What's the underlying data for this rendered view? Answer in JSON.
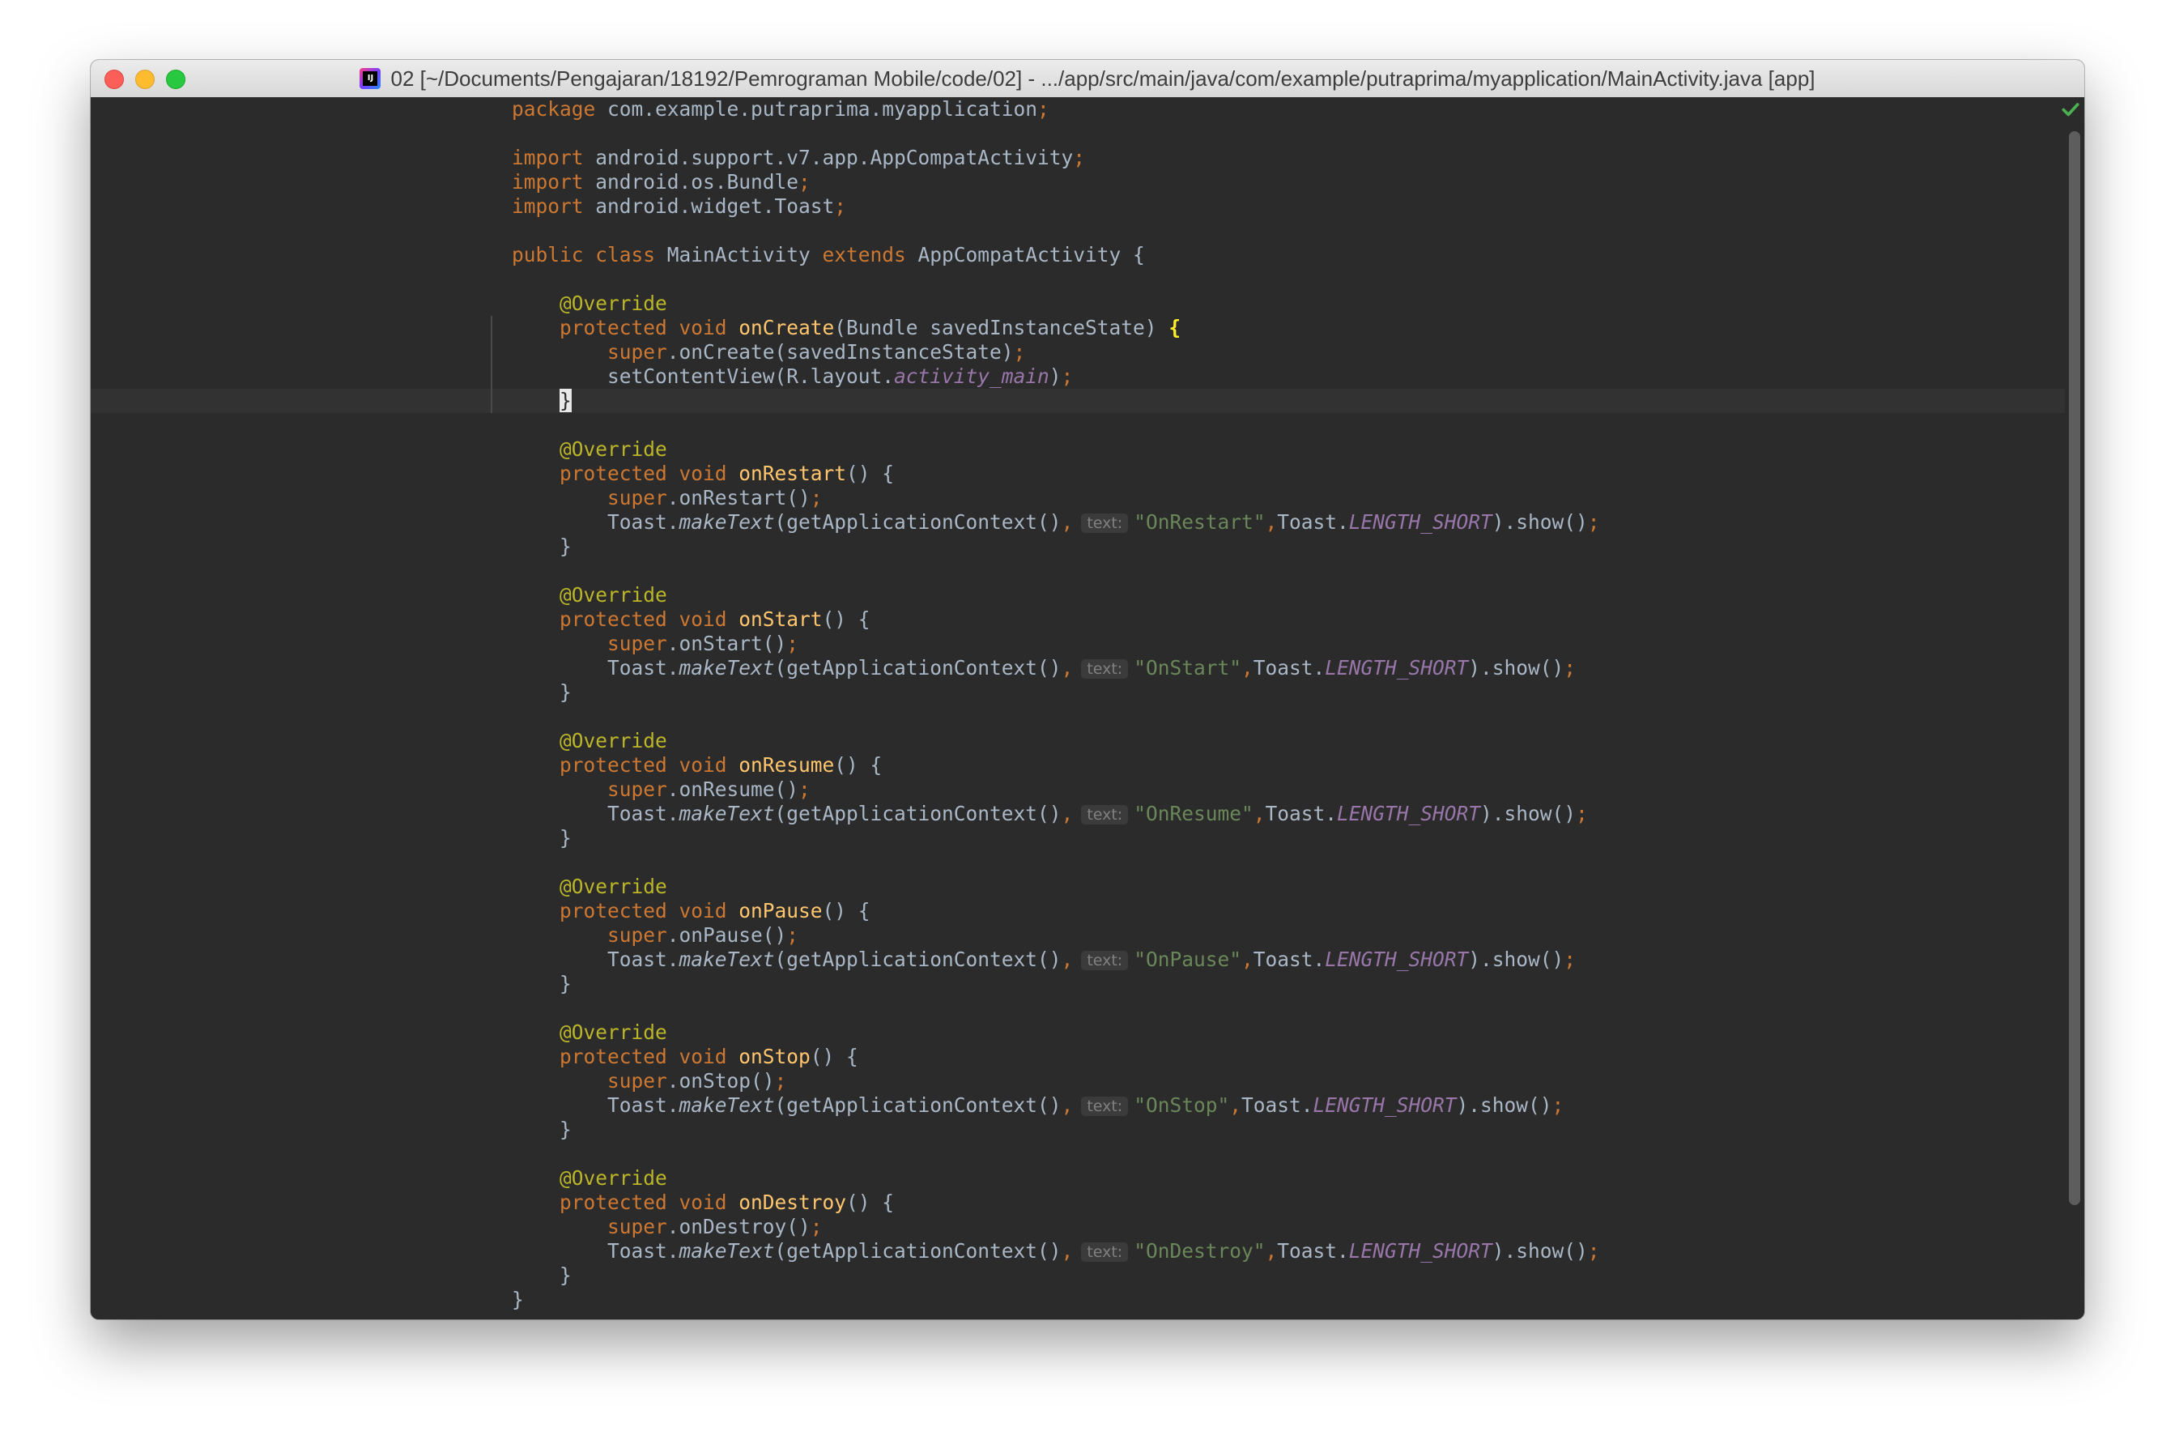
{
  "window": {
    "title": "02 [~/Documents/Pengajaran/18192/Pemrograman Mobile/code/02] - .../app/src/main/java/com/example/putraprima/myapplication/MainActivity.java [app]",
    "app_icon": "intellij-idea-icon",
    "status_icon": "check-icon"
  },
  "colors": {
    "keyword": "#cc7832",
    "method": "#ffc66d",
    "annotation": "#bbb529",
    "field": "#9876aa",
    "string": "#6a8759",
    "text": "#a9b7c6",
    "background": "#2b2b2b",
    "status_ok": "#4caf50"
  },
  "editor": {
    "cursor_line": 13,
    "lines": [
      [
        {
          "t": "package",
          "c": "keyword"
        },
        {
          "t": " com.example.putraprima.myapplication",
          "c": "plain"
        },
        {
          "t": ";",
          "c": "punct"
        }
      ],
      [],
      [
        {
          "t": "import",
          "c": "keyword"
        },
        {
          "t": " android.support.v7.app.AppCompatActivity",
          "c": "plain"
        },
        {
          "t": ";",
          "c": "punct"
        }
      ],
      [
        {
          "t": "import",
          "c": "keyword"
        },
        {
          "t": " android.os.Bundle",
          "c": "plain"
        },
        {
          "t": ";",
          "c": "punct"
        }
      ],
      [
        {
          "t": "import",
          "c": "keyword"
        },
        {
          "t": " android.widget.Toast",
          "c": "plain"
        },
        {
          "t": ";",
          "c": "punct"
        }
      ],
      [],
      [
        {
          "t": "public class ",
          "c": "keyword"
        },
        {
          "t": "MainActivity ",
          "c": "plain"
        },
        {
          "t": "extends ",
          "c": "keyword"
        },
        {
          "t": "AppCompatActivity {",
          "c": "plain"
        }
      ],
      [],
      [
        {
          "t": "    ",
          "c": "plain"
        },
        {
          "t": "@Override",
          "c": "annotation"
        }
      ],
      [
        {
          "t": "    ",
          "c": "plain"
        },
        {
          "t": "protected void ",
          "c": "keyword"
        },
        {
          "t": "onCreate",
          "c": "method"
        },
        {
          "t": "(Bundle savedInstanceState) ",
          "c": "plain"
        },
        {
          "t": "{",
          "c": "brace-hl"
        }
      ],
      [
        {
          "t": "        ",
          "c": "plain"
        },
        {
          "t": "super",
          "c": "keyword"
        },
        {
          "t": ".onCreate(savedInstanceState)",
          "c": "plain"
        },
        {
          "t": ";",
          "c": "punct"
        }
      ],
      [
        {
          "t": "        setContentView(R.layout.",
          "c": "plain"
        },
        {
          "t": "activity_main",
          "c": "field"
        },
        {
          "t": ")",
          "c": "plain"
        },
        {
          "t": ";",
          "c": "punct"
        }
      ],
      [
        {
          "t": "    ",
          "c": "plain"
        },
        {
          "t": "}",
          "c": "cursor"
        }
      ],
      [],
      [
        {
          "t": "    ",
          "c": "plain"
        },
        {
          "t": "@Override",
          "c": "annotation"
        }
      ],
      [
        {
          "t": "    ",
          "c": "plain"
        },
        {
          "t": "protected void ",
          "c": "keyword"
        },
        {
          "t": "onRestart",
          "c": "method"
        },
        {
          "t": "() {",
          "c": "plain"
        }
      ],
      [
        {
          "t": "        ",
          "c": "plain"
        },
        {
          "t": "super",
          "c": "keyword"
        },
        {
          "t": ".onRestart()",
          "c": "plain"
        },
        {
          "t": ";",
          "c": "punct"
        }
      ],
      [
        {
          "t": "        Toast.",
          "c": "plain"
        },
        {
          "t": "makeText",
          "c": "static"
        },
        {
          "t": "(getApplicationContext()",
          "c": "plain"
        },
        {
          "t": ",",
          "c": "punct"
        },
        {
          "t": "text:",
          "c": "hint"
        },
        {
          "t": "\"OnRestart\"",
          "c": "string"
        },
        {
          "t": ",",
          "c": "punct"
        },
        {
          "t": "Toast.",
          "c": "plain"
        },
        {
          "t": "LENGTH_SHORT",
          "c": "field"
        },
        {
          "t": ").show()",
          "c": "plain"
        },
        {
          "t": ";",
          "c": "punct"
        }
      ],
      [
        {
          "t": "    }",
          "c": "plain"
        }
      ],
      [],
      [
        {
          "t": "    ",
          "c": "plain"
        },
        {
          "t": "@Override",
          "c": "annotation"
        }
      ],
      [
        {
          "t": "    ",
          "c": "plain"
        },
        {
          "t": "protected void ",
          "c": "keyword"
        },
        {
          "t": "onStart",
          "c": "method"
        },
        {
          "t": "() {",
          "c": "plain"
        }
      ],
      [
        {
          "t": "        ",
          "c": "plain"
        },
        {
          "t": "super",
          "c": "keyword"
        },
        {
          "t": ".onStart()",
          "c": "plain"
        },
        {
          "t": ";",
          "c": "punct"
        }
      ],
      [
        {
          "t": "        Toast.",
          "c": "plain"
        },
        {
          "t": "makeText",
          "c": "static"
        },
        {
          "t": "(getApplicationContext()",
          "c": "plain"
        },
        {
          "t": ",",
          "c": "punct"
        },
        {
          "t": "text:",
          "c": "hint"
        },
        {
          "t": "\"OnStart\"",
          "c": "string"
        },
        {
          "t": ",",
          "c": "punct"
        },
        {
          "t": "Toast.",
          "c": "plain"
        },
        {
          "t": "LENGTH_SHORT",
          "c": "field"
        },
        {
          "t": ").show()",
          "c": "plain"
        },
        {
          "t": ";",
          "c": "punct"
        }
      ],
      [
        {
          "t": "    }",
          "c": "plain"
        }
      ],
      [],
      [
        {
          "t": "    ",
          "c": "plain"
        },
        {
          "t": "@Override",
          "c": "annotation"
        }
      ],
      [
        {
          "t": "    ",
          "c": "plain"
        },
        {
          "t": "protected void ",
          "c": "keyword"
        },
        {
          "t": "onResume",
          "c": "method"
        },
        {
          "t": "() {",
          "c": "plain"
        }
      ],
      [
        {
          "t": "        ",
          "c": "plain"
        },
        {
          "t": "super",
          "c": "keyword"
        },
        {
          "t": ".onResume()",
          "c": "plain"
        },
        {
          "t": ";",
          "c": "punct"
        }
      ],
      [
        {
          "t": "        Toast.",
          "c": "plain"
        },
        {
          "t": "makeText",
          "c": "static"
        },
        {
          "t": "(getApplicationContext()",
          "c": "plain"
        },
        {
          "t": ",",
          "c": "punct"
        },
        {
          "t": "text:",
          "c": "hint"
        },
        {
          "t": "\"OnResume\"",
          "c": "string"
        },
        {
          "t": ",",
          "c": "punct"
        },
        {
          "t": "Toast.",
          "c": "plain"
        },
        {
          "t": "LENGTH_SHORT",
          "c": "field"
        },
        {
          "t": ").show()",
          "c": "plain"
        },
        {
          "t": ";",
          "c": "punct"
        }
      ],
      [
        {
          "t": "    }",
          "c": "plain"
        }
      ],
      [],
      [
        {
          "t": "    ",
          "c": "plain"
        },
        {
          "t": "@Override",
          "c": "annotation"
        }
      ],
      [
        {
          "t": "    ",
          "c": "plain"
        },
        {
          "t": "protected void ",
          "c": "keyword"
        },
        {
          "t": "onPause",
          "c": "method"
        },
        {
          "t": "() {",
          "c": "plain"
        }
      ],
      [
        {
          "t": "        ",
          "c": "plain"
        },
        {
          "t": "super",
          "c": "keyword"
        },
        {
          "t": ".onPause()",
          "c": "plain"
        },
        {
          "t": ";",
          "c": "punct"
        }
      ],
      [
        {
          "t": "        Toast.",
          "c": "plain"
        },
        {
          "t": "makeText",
          "c": "static"
        },
        {
          "t": "(getApplicationContext()",
          "c": "plain"
        },
        {
          "t": ",",
          "c": "punct"
        },
        {
          "t": "text:",
          "c": "hint"
        },
        {
          "t": "\"OnPause\"",
          "c": "string"
        },
        {
          "t": ",",
          "c": "punct"
        },
        {
          "t": "Toast.",
          "c": "plain"
        },
        {
          "t": "LENGTH_SHORT",
          "c": "field"
        },
        {
          "t": ").show()",
          "c": "plain"
        },
        {
          "t": ";",
          "c": "punct"
        }
      ],
      [
        {
          "t": "    }",
          "c": "plain"
        }
      ],
      [],
      [
        {
          "t": "    ",
          "c": "plain"
        },
        {
          "t": "@Override",
          "c": "annotation"
        }
      ],
      [
        {
          "t": "    ",
          "c": "plain"
        },
        {
          "t": "protected void ",
          "c": "keyword"
        },
        {
          "t": "onStop",
          "c": "method"
        },
        {
          "t": "() {",
          "c": "plain"
        }
      ],
      [
        {
          "t": "        ",
          "c": "plain"
        },
        {
          "t": "super",
          "c": "keyword"
        },
        {
          "t": ".onStop()",
          "c": "plain"
        },
        {
          "t": ";",
          "c": "punct"
        }
      ],
      [
        {
          "t": "        Toast.",
          "c": "plain"
        },
        {
          "t": "makeText",
          "c": "static"
        },
        {
          "t": "(getApplicationContext()",
          "c": "plain"
        },
        {
          "t": ",",
          "c": "punct"
        },
        {
          "t": "text:",
          "c": "hint"
        },
        {
          "t": "\"OnStop\"",
          "c": "string"
        },
        {
          "t": ",",
          "c": "punct"
        },
        {
          "t": "Toast.",
          "c": "plain"
        },
        {
          "t": "LENGTH_SHORT",
          "c": "field"
        },
        {
          "t": ").show()",
          "c": "plain"
        },
        {
          "t": ";",
          "c": "punct"
        }
      ],
      [
        {
          "t": "    }",
          "c": "plain"
        }
      ],
      [],
      [
        {
          "t": "    ",
          "c": "plain"
        },
        {
          "t": "@Override",
          "c": "annotation"
        }
      ],
      [
        {
          "t": "    ",
          "c": "plain"
        },
        {
          "t": "protected void ",
          "c": "keyword"
        },
        {
          "t": "onDestroy",
          "c": "method"
        },
        {
          "t": "() {",
          "c": "plain"
        }
      ],
      [
        {
          "t": "        ",
          "c": "plain"
        },
        {
          "t": "super",
          "c": "keyword"
        },
        {
          "t": ".onDestroy()",
          "c": "plain"
        },
        {
          "t": ";",
          "c": "punct"
        }
      ],
      [
        {
          "t": "        Toast.",
          "c": "plain"
        },
        {
          "t": "makeText",
          "c": "static"
        },
        {
          "t": "(getApplicationContext()",
          "c": "plain"
        },
        {
          "t": ",",
          "c": "punct"
        },
        {
          "t": "text:",
          "c": "hint"
        },
        {
          "t": "\"OnDestroy\"",
          "c": "string"
        },
        {
          "t": ",",
          "c": "punct"
        },
        {
          "t": "Toast.",
          "c": "plain"
        },
        {
          "t": "LENGTH_SHORT",
          "c": "field"
        },
        {
          "t": ").show()",
          "c": "plain"
        },
        {
          "t": ";",
          "c": "punct"
        }
      ],
      [
        {
          "t": "    }",
          "c": "plain"
        }
      ],
      [
        {
          "t": "}",
          "c": "plain"
        }
      ]
    ]
  }
}
